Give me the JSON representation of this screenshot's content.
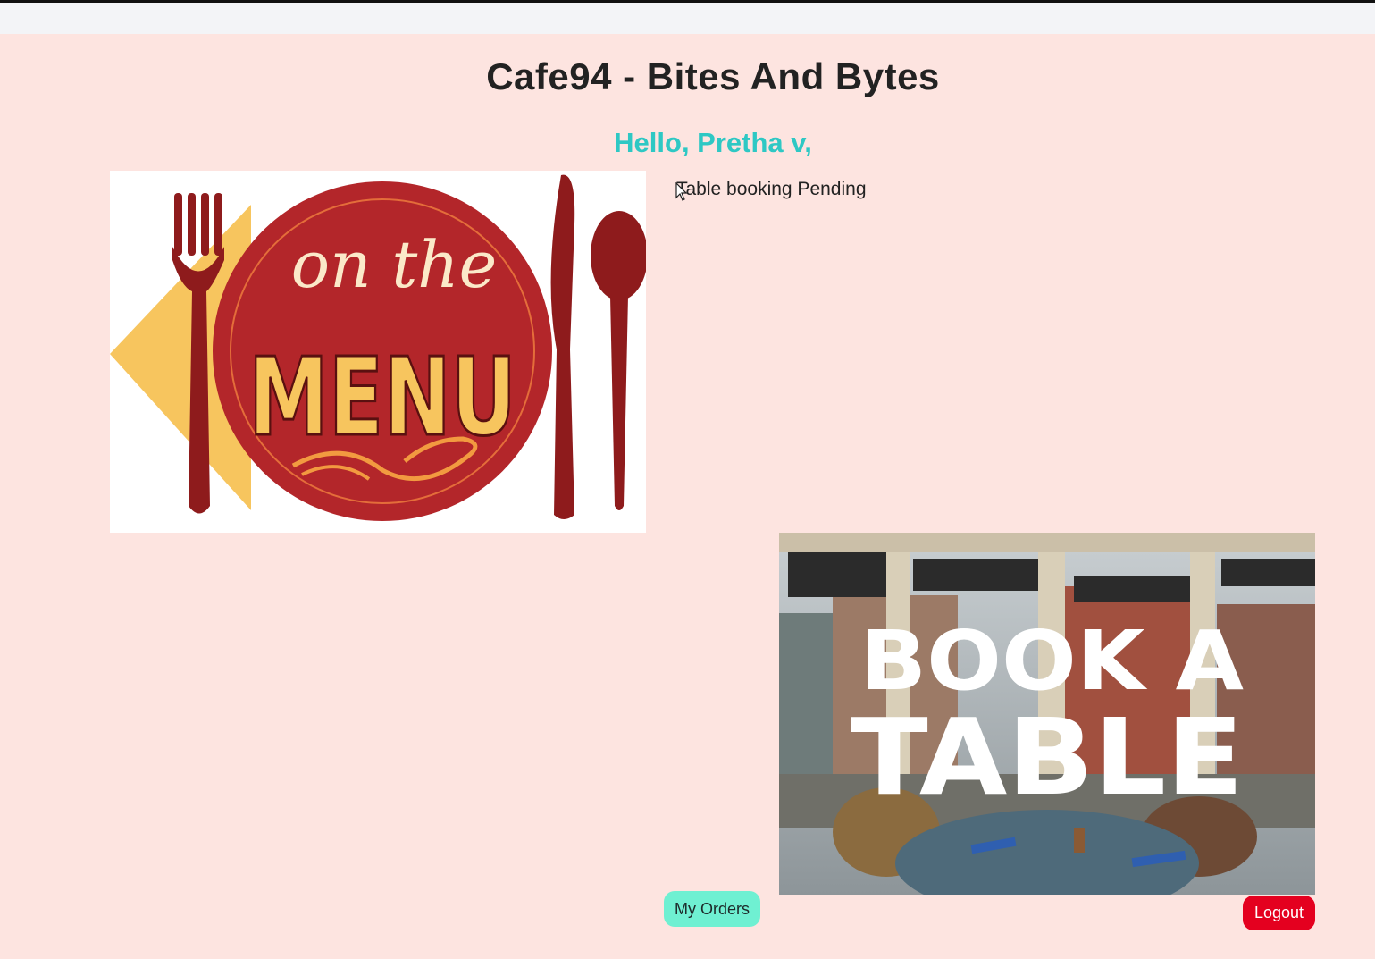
{
  "header": {
    "title": "Cafe94 - Bites And Bytes",
    "greeting": "Hello, Pretha v,"
  },
  "status": {
    "text": "Table booking Pending"
  },
  "menu_card": {
    "line1": "on the",
    "line2": "MENU",
    "icon": "fork-knife-spoon-icon"
  },
  "book_card": {
    "line1": "BOOK A",
    "line2": "TABLE"
  },
  "buttons": {
    "orders": "My Orders",
    "logout": "Logout"
  },
  "colors": {
    "background": "#fde4e0",
    "greeting": "#2ec8c4",
    "orders_button": "#6ff0d2",
    "logout_button": "#e4001f",
    "menu_red": "#b3262a",
    "menu_yellow": "#f7c55e"
  }
}
